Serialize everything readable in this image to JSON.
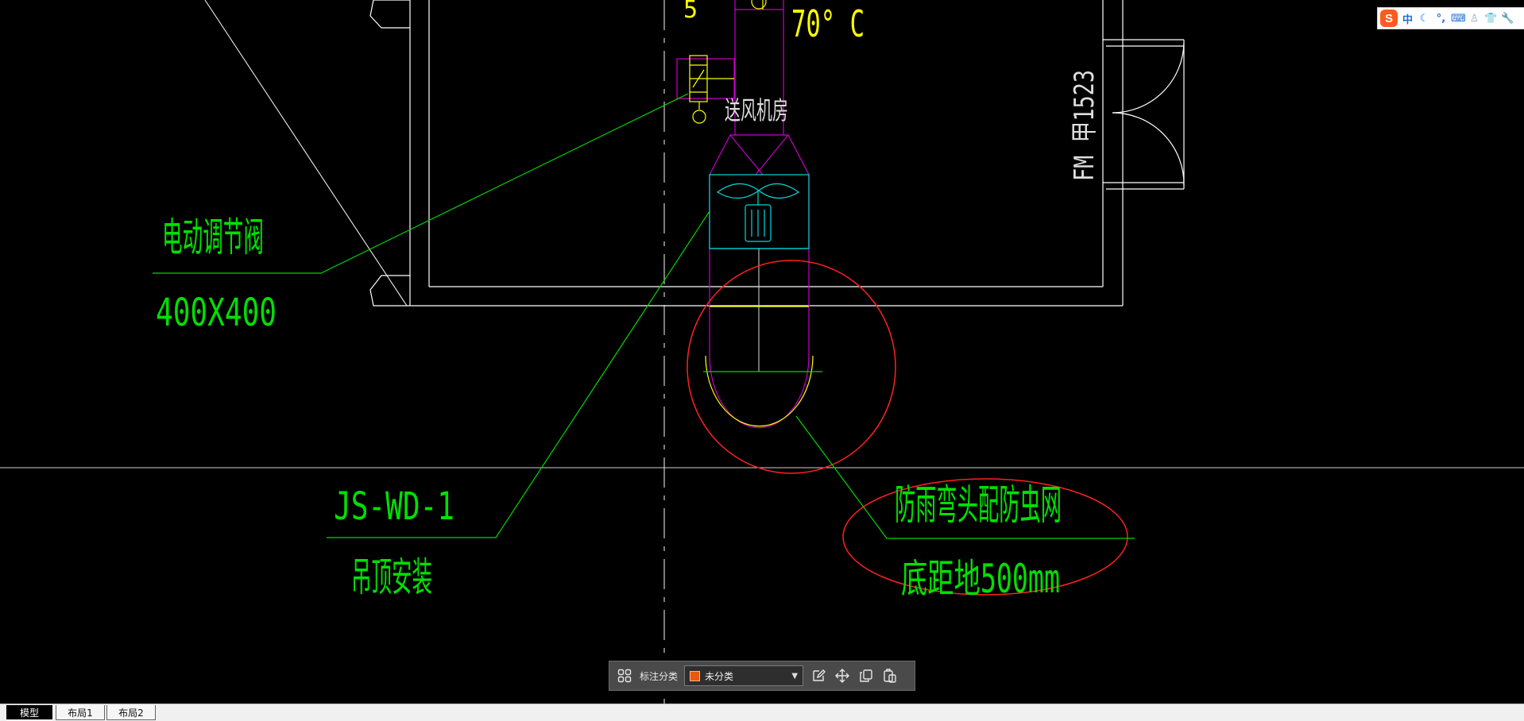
{
  "drawing": {
    "labels": {
      "temp": "70° C",
      "top_digit": "5",
      "room": "送风机房",
      "door": "FM 甲1523",
      "valve_name": "电动调节阀",
      "valve_size": "400X400",
      "fan_model": "JS-WD-1",
      "fan_install": "吊顶安装",
      "elbow_line1": "防雨弯头配防虫网",
      "elbow_line2": "底距地500mm"
    },
    "colors": {
      "background": "#000000",
      "wall": "#ffffff",
      "duct": "#c800c8",
      "fan": "#00d8d8",
      "leader": "#00d800",
      "label_text": "#00e000",
      "yellow": "#ffff00",
      "cloud": "#ff2020"
    }
  },
  "ime": {
    "logo": "S",
    "items": [
      "中",
      "☾",
      "°,",
      "⌨",
      "♙",
      "👕",
      "🔧"
    ]
  },
  "annotation_toolbar": {
    "label": "标注分类",
    "selected": "未分类",
    "icons": [
      "grid-icon",
      "edit-icon",
      "move-icon",
      "copy-icon",
      "paste-icon"
    ]
  },
  "layout_tabs": [
    "模型",
    "布局1",
    "布局2"
  ]
}
